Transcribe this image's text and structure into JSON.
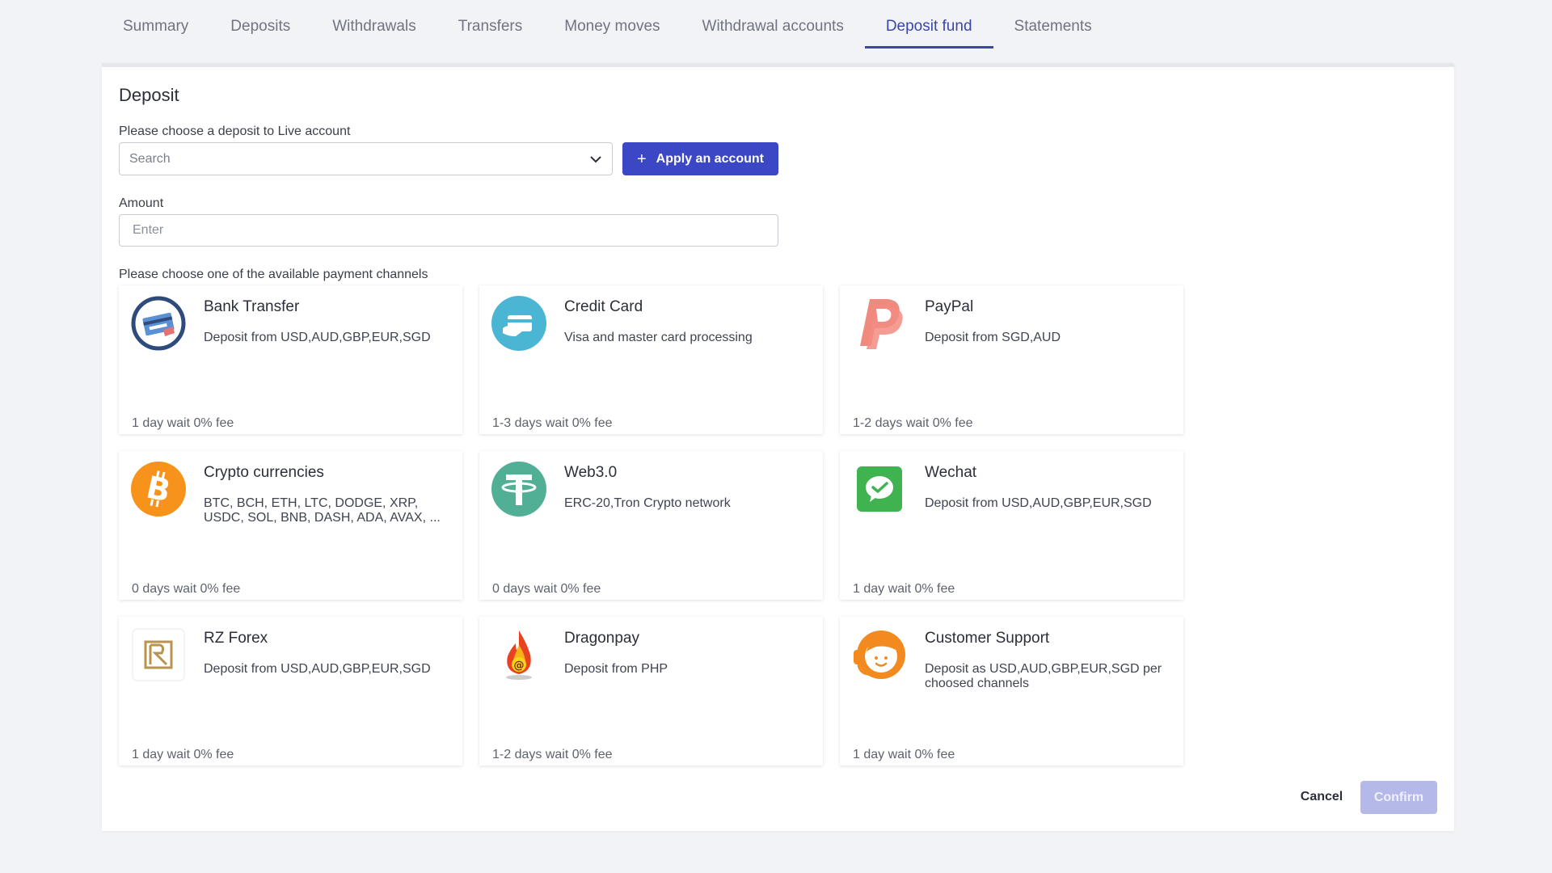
{
  "tabs": [
    {
      "label": "Summary",
      "active": false
    },
    {
      "label": "Deposits",
      "active": false
    },
    {
      "label": "Withdrawals",
      "active": false
    },
    {
      "label": "Transfers",
      "active": false
    },
    {
      "label": "Money moves",
      "active": false
    },
    {
      "label": "Withdrawal accounts",
      "active": false
    },
    {
      "label": "Deposit fund",
      "active": true
    },
    {
      "label": "Statements",
      "active": false
    }
  ],
  "deposit": {
    "title": "Deposit",
    "account_label": "Please choose a deposit to Live account",
    "account_placeholder": "Search",
    "apply_button": "Apply an account",
    "amount_label": "Amount",
    "amount_placeholder": "Enter",
    "channels_label": "Please choose one of the available payment channels"
  },
  "channels": [
    {
      "name": "Bank Transfer",
      "desc": "Deposit from USD,AUD,GBP,EUR,SGD",
      "meta": "1 day wait 0% fee",
      "icon": "bank-transfer-icon"
    },
    {
      "name": "Credit Card",
      "desc": "Visa and master card processing",
      "meta": "1-3 days wait 0% fee",
      "icon": "credit-card-icon"
    },
    {
      "name": "PayPal",
      "desc": "Deposit from SGD,AUD",
      "meta": "1-2 days wait 0% fee",
      "icon": "paypal-icon"
    },
    {
      "name": "Crypto currencies",
      "desc": "BTC, BCH, ETH, LTC, DODGE, XRP, USDC, SOL, BNB, DASH, ADA, AVAX, ...",
      "meta": "0 days wait 0% fee",
      "icon": "bitcoin-icon"
    },
    {
      "name": "Web3.0",
      "desc": "ERC-20,Tron Crypto network",
      "meta": "0 days wait 0% fee",
      "icon": "tether-icon"
    },
    {
      "name": "Wechat",
      "desc": "Deposit from USD,AUD,GBP,EUR,SGD",
      "meta": "1 day wait 0% fee",
      "icon": "wechat-icon"
    },
    {
      "name": "RZ Forex",
      "desc": "Deposit from USD,AUD,GBP,EUR,SGD",
      "meta": "1 day wait 0% fee",
      "icon": "rz-forex-icon"
    },
    {
      "name": "Dragonpay",
      "desc": "Deposit from PHP",
      "meta": "1-2 days wait 0% fee",
      "icon": "dragonpay-icon"
    },
    {
      "name": "Customer Support",
      "desc": "Deposit as USD,AUD,GBP,EUR,SGD per choosed channels",
      "meta": "1 day wait 0% fee",
      "icon": "customer-support-icon"
    }
  ],
  "actions": {
    "cancel": "Cancel",
    "confirm": "Confirm"
  },
  "colors": {
    "accent": "#3b47c4",
    "confirm_disabled": "#b5b9ea"
  }
}
